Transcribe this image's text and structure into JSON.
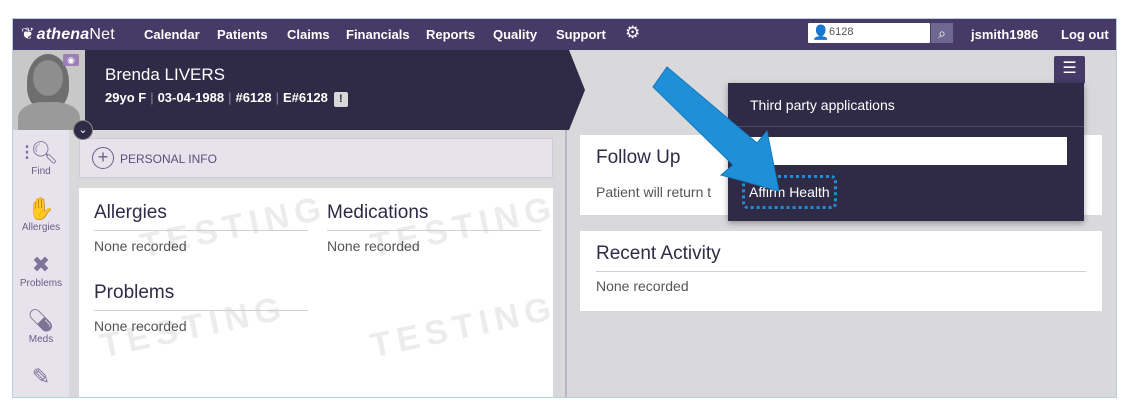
{
  "topnav": {
    "logo_prefix": "athena",
    "logo_suffix": "Net",
    "items": [
      "Calendar",
      "Patients",
      "Claims",
      "Financials",
      "Reports",
      "Quality",
      "Support"
    ],
    "search_value": "6128",
    "username": "jsmith1986",
    "logout": "Log out"
  },
  "patient": {
    "name": "Brenda LIVERS",
    "age_sex": "29yo F",
    "dob": "03-04-1988",
    "mrn": "#6128",
    "enterprise_id": "E#6128",
    "alert": "!"
  },
  "sidebar": {
    "items": [
      {
        "label": "Find",
        "icon": "find-icon"
      },
      {
        "label": "Allergies",
        "icon": "allergies-icon"
      },
      {
        "label": "Problems",
        "icon": "problems-icon"
      },
      {
        "label": "Meds",
        "icon": "meds-icon"
      },
      {
        "label": "",
        "icon": "vaccine-icon"
      }
    ]
  },
  "personal_info": {
    "label": "PERSONAL INFO"
  },
  "clinical": {
    "allergies_title": "Allergies",
    "allergies_value": "None recorded",
    "medications_title": "Medications",
    "medications_value": "None recorded",
    "problems_title": "Problems",
    "problems_value": "None recorded",
    "watermark": "TESTING"
  },
  "followup": {
    "title": "Follow Up",
    "value": "Patient will return t"
  },
  "recent": {
    "title": "Recent Activity",
    "value": "None recorded"
  },
  "dropdown": {
    "title": "Third party applications",
    "search_placeholder": "",
    "app_item": "Affirm Health"
  },
  "colors": {
    "nav_bg": "#463a66",
    "banner_bg": "#2f2a45",
    "highlight": "#1e8fd6"
  }
}
